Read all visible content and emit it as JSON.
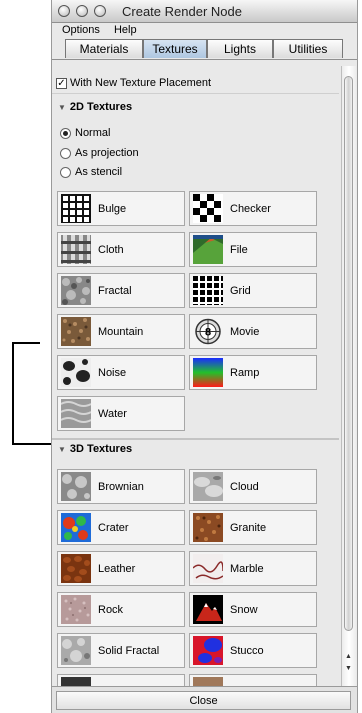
{
  "window": {
    "title": "Create Render Node"
  },
  "menu": [
    "Options",
    "Help"
  ],
  "tabs": [
    "Materials",
    "Textures",
    "Lights",
    "Utilities"
  ],
  "active_tab": "Textures",
  "placement": {
    "label": "With New Texture Placement",
    "checked": true
  },
  "textures2d": {
    "title": "2D Textures",
    "radios": [
      {
        "label": "Normal",
        "selected": true
      },
      {
        "label": "As projection",
        "selected": false
      },
      {
        "label": "As stencil",
        "selected": false
      }
    ],
    "items": [
      "Bulge",
      "Checker",
      "Cloth",
      "File",
      "Fractal",
      "Grid",
      "Mountain",
      "Movie",
      "Noise",
      "Ramp",
      "Water"
    ]
  },
  "textures3d": {
    "title": "3D Textures",
    "items": [
      "Brownian",
      "Cloud",
      "Crater",
      "Granite",
      "Leather",
      "Marble",
      "Rock",
      "Snow",
      "Solid Fractal",
      "Stucco"
    ]
  },
  "footer": {
    "close_label": "Close"
  }
}
